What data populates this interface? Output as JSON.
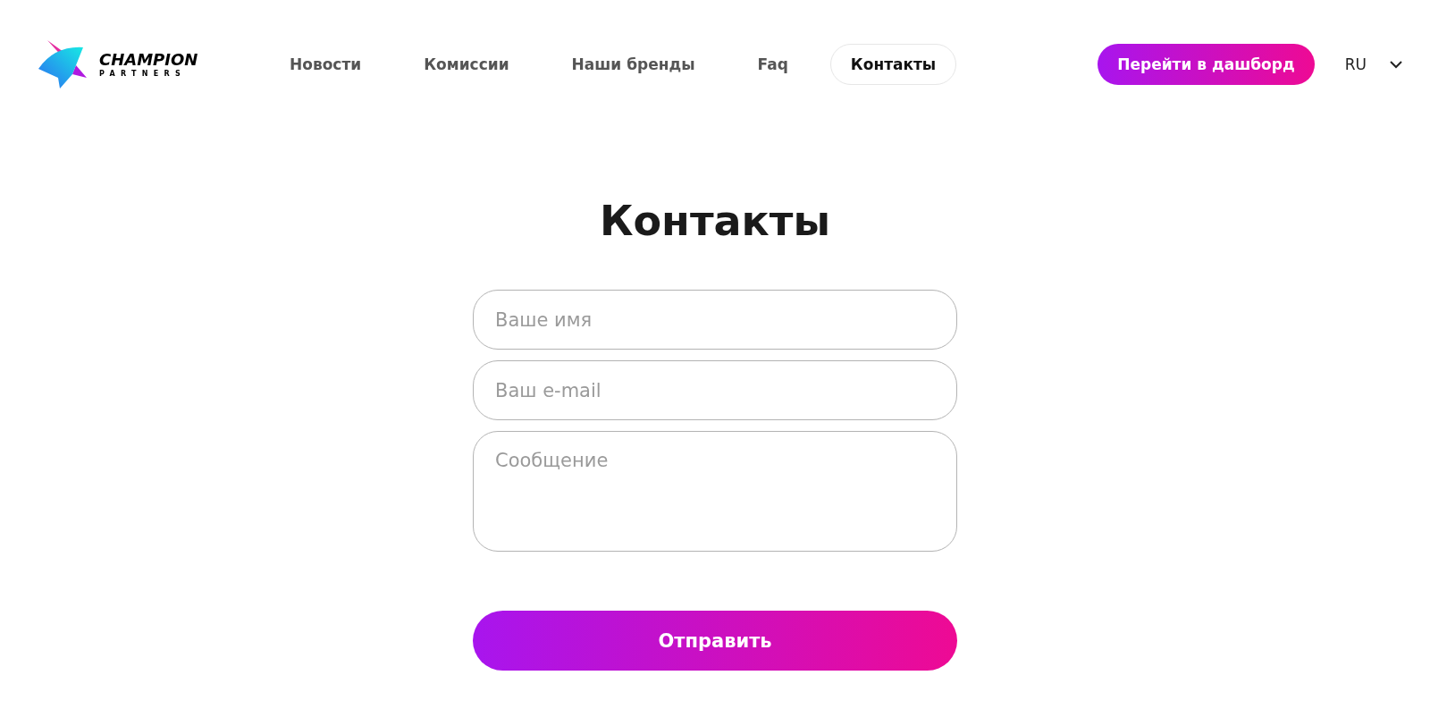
{
  "header": {
    "logo": {
      "title": "CHAMPION",
      "subtitle": "PARTNERS"
    },
    "nav": [
      {
        "label": "Новости",
        "selected": false
      },
      {
        "label": "Комиссии",
        "selected": false
      },
      {
        "label": "Наши бренды",
        "selected": false
      },
      {
        "label": "Faq",
        "selected": false
      },
      {
        "label": "Контакты",
        "selected": true
      }
    ],
    "dashboard_button": "Перейти в дашборд",
    "language": "RU"
  },
  "page": {
    "title": "Контакты",
    "fields": [
      {
        "kind": "input",
        "placeholder": "Ваше имя"
      },
      {
        "kind": "input",
        "placeholder": "Ваш e-mail"
      },
      {
        "kind": "textarea",
        "placeholder": "Сообщение"
      }
    ],
    "submit": "Отправить"
  }
}
